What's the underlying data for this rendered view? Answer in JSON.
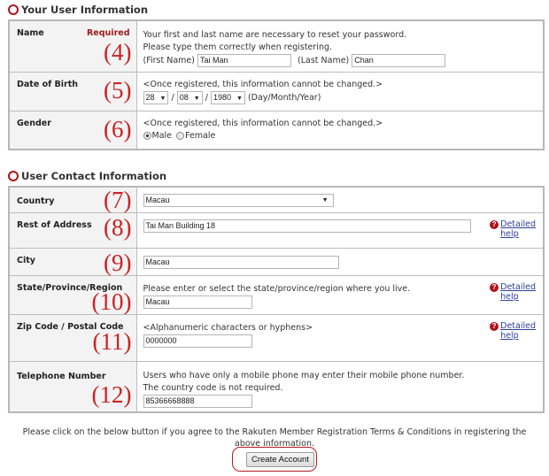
{
  "sections": {
    "user_info_title": "Your User Information",
    "contact_info_title": "User Contact Information"
  },
  "name_row": {
    "label": "Name",
    "required": "Required",
    "annotation": "(4)",
    "line1": "Your first and last name are necessary to reset your password.",
    "line2": "Please type them correctly when registering.",
    "first_label": "(First Name)",
    "first_value": "Tai Man",
    "last_label": "(Last Name)",
    "last_value": "Chan"
  },
  "dob_row": {
    "label": "Date of Birth",
    "annotation": "(5)",
    "note": "<Once registered, this information cannot be changed.>",
    "day": "28",
    "month": "08",
    "year": "1980",
    "separator": "/",
    "format": "(Day/Month/Year)"
  },
  "gender_row": {
    "label": "Gender",
    "annotation": "(6)",
    "note": "<Once registered, this information cannot be changed.>",
    "options": [
      "Male",
      "Female"
    ],
    "selected": "Male"
  },
  "country_row": {
    "label": "Country",
    "annotation": "(7)",
    "value": "Macau"
  },
  "address_row": {
    "label": "Rest of Address",
    "annotation": "(8)",
    "value": "Tai Man Building 18",
    "help_line1": "Detailed",
    "help_line2": "help"
  },
  "city_row": {
    "label": "City",
    "annotation": "(9)",
    "value": "Macau"
  },
  "state_row": {
    "label": "State/Province/Region",
    "annotation": "(10)",
    "note": "Please enter or select the state/province/region where you live.",
    "value": "Macau",
    "help_line1": "Detailed",
    "help_line2": "help"
  },
  "zip_row": {
    "label": "Zip Code / Postal Code",
    "annotation": "(11)",
    "note": "<Alphanumeric characters or hyphens>",
    "value": "0000000",
    "help_line1": "Detailed",
    "help_line2": "help"
  },
  "phone_row": {
    "label": "Telephone Number",
    "annotation": "(12)",
    "note1": "Users who have only a mobile phone may enter their mobile phone number.",
    "note2": "The country code is not required.",
    "value": "85366668888"
  },
  "footer": {
    "agree_text": "Please click on the below button if you agree to the Rakuten Member Registration Terms & Conditions in registering the above information.",
    "create_button": "Create Account"
  },
  "colors": {
    "accent": "#b0121b",
    "annotation": "#cc2222",
    "link": "#2b3f9a"
  }
}
